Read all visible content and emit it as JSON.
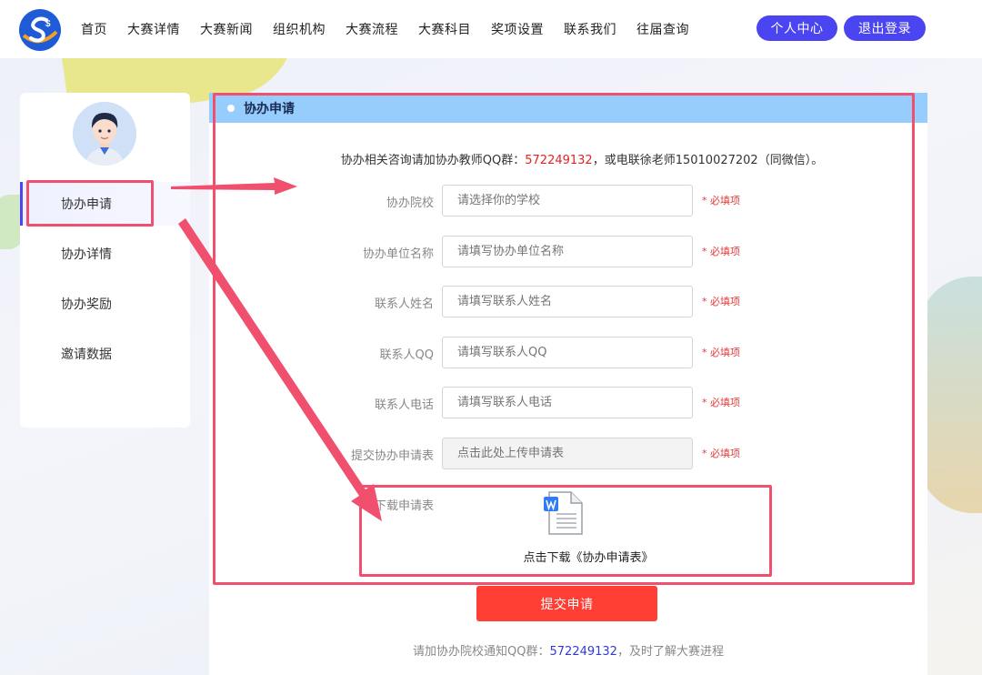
{
  "nav": {
    "items": [
      "首页",
      "大赛详情",
      "大赛新闻",
      "组织机构",
      "大赛流程",
      "大赛科目",
      "奖项设置",
      "联系我们",
      "往届查询"
    ],
    "personal_center": "个人中心",
    "logout": "退出登录"
  },
  "sidebar": {
    "items": [
      {
        "label": "协办申请",
        "active": true
      },
      {
        "label": "协办详情",
        "active": false
      },
      {
        "label": "协办奖励",
        "active": false
      },
      {
        "label": "邀请数据",
        "active": false
      }
    ]
  },
  "panel": {
    "title": "协办申请",
    "notice_prefix": "协办相关咨询请加协办教师QQ群：",
    "notice_qq": "572249132",
    "notice_suffix": "，或电联徐老师15010027202（同微信）。",
    "fields": [
      {
        "label": "协办院校",
        "placeholder": "请选择你的学校",
        "required": "* 必填项"
      },
      {
        "label": "协办单位名称",
        "placeholder": "请填写协办单位名称",
        "required": "* 必填项"
      },
      {
        "label": "联系人姓名",
        "placeholder": "请填写联系人姓名",
        "required": "* 必填项"
      },
      {
        "label": "联系人QQ",
        "placeholder": "请填写联系人QQ",
        "required": "* 必填项"
      },
      {
        "label": "联系人电话",
        "placeholder": "请填写联系人电话",
        "required": "* 必填项"
      },
      {
        "label": "提交协办申请表",
        "placeholder": "点击此处上传申请表",
        "required": "* 必填项"
      }
    ],
    "download_label": "下载申请表",
    "download_link": "点击下载《协办申请表》",
    "submit": "提交申请",
    "footer_prefix": "请加协办院校通知QQ群：",
    "footer_qq": "572249132",
    "footer_suffix": "，及时了解大赛进程"
  },
  "colors": {
    "primary": "#4a45f0",
    "header_blue": "#96cdfd",
    "submit_red": "#ff3f34",
    "annotation": "#f0506e",
    "required_red": "#e23b3b"
  },
  "icons": [
    "logo-icon",
    "avatar-icon",
    "word-document-icon"
  ]
}
